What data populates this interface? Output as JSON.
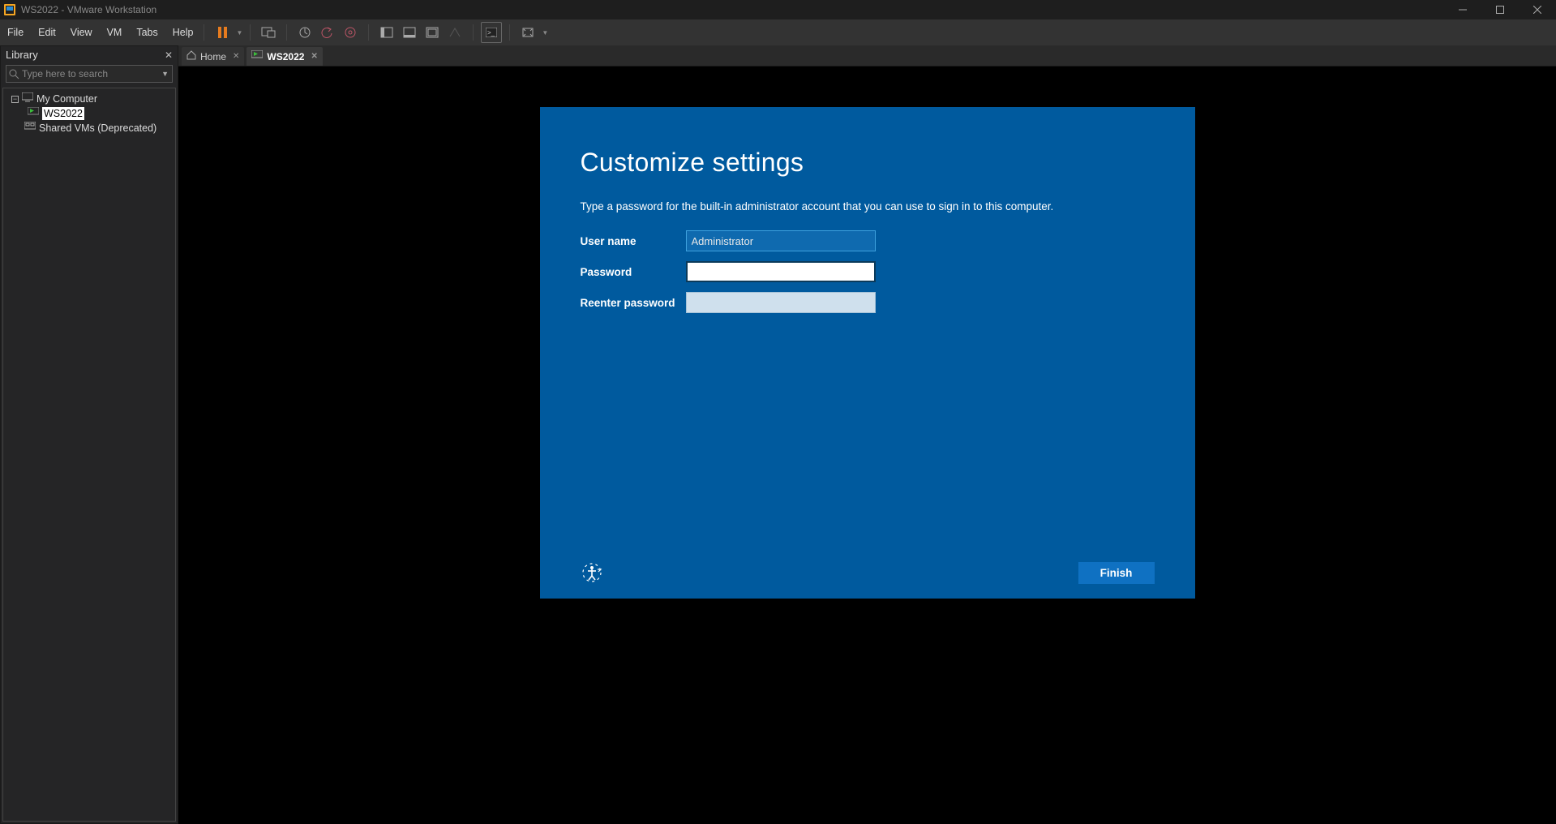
{
  "window": {
    "title": "WS2022 - VMware Workstation"
  },
  "menu": {
    "items": [
      "File",
      "Edit",
      "View",
      "VM",
      "Tabs",
      "Help"
    ]
  },
  "library": {
    "title": "Library",
    "search_placeholder": "Type here to search",
    "tree": {
      "root": "My Computer",
      "vm": "WS2022",
      "shared": "Shared VMs (Deprecated)"
    }
  },
  "tabs": {
    "home": "Home",
    "vm": "WS2022"
  },
  "oobe": {
    "title": "Customize settings",
    "subtitle": "Type a password for the built-in administrator account that you can use to sign in to this computer.",
    "labels": {
      "username": "User name",
      "password": "Password",
      "reenter": "Reenter password"
    },
    "username_value": "Administrator",
    "finish": "Finish"
  }
}
